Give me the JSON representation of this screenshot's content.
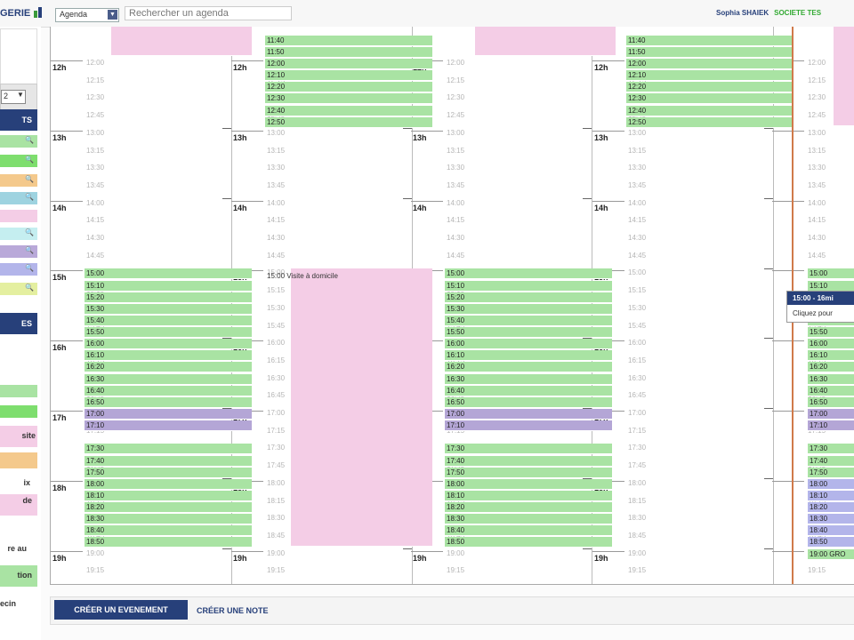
{
  "header": {
    "brand": "GERIE",
    "agenda_select": "Agenda",
    "search_placeholder": "Rechercher un agenda",
    "user_name": "Sophia SHAIEK",
    "company": "SOCIETE TES"
  },
  "sidebar": {
    "select_value": "2",
    "section1_header": "TS",
    "section2_header": "ES",
    "labels": [
      "site",
      "ix",
      "de",
      "re au",
      "tion",
      "ecin"
    ]
  },
  "calendar": {
    "hours": [
      "12h",
      "13h",
      "14h",
      "15h",
      "16h",
      "17h",
      "18h",
      "19h"
    ],
    "slot_times": [
      "12:00",
      "12:15",
      "12:30",
      "12:45",
      "13:00",
      "13:15",
      "13:30",
      "13:45",
      "14:00",
      "14:15",
      "14:30",
      "14:45",
      "15:00",
      "15:15",
      "15:30",
      "15:45",
      "16:00",
      "16:15",
      "16:30",
      "16:45",
      "17:00",
      "17:15",
      "17:30",
      "17:45",
      "18:00",
      "18:15",
      "18:30",
      "18:45",
      "19:00",
      "19:15"
    ],
    "event_times_top": [
      "11:40",
      "11:50",
      "12:00",
      "12:10",
      "12:20",
      "12:30",
      "12:40",
      "12:50"
    ],
    "event_times_pm": [
      "15:00",
      "15:10",
      "15:20",
      "15:30",
      "15:40",
      "15:50",
      "16:00",
      "16:10",
      "16:20",
      "16:30",
      "16:40",
      "16:50"
    ],
    "event_times_17": [
      "17:00",
      "17:10"
    ],
    "event_times_late": [
      "17:30",
      "17:40",
      "17:50",
      "18:00",
      "18:10",
      "18:20",
      "18:30",
      "18:40",
      "18:50"
    ],
    "visite_label": "15:00  Visite à  domicile",
    "last_col_event": "19:00 GRO",
    "tooltip_title": "15:00 - 16mi",
    "tooltip_text": "Cliquez pour"
  },
  "footer": {
    "create_event": "CRÉER UN EVENEMENT",
    "create_note": "CRÉER UNE NOTE"
  },
  "colors": {
    "navy": "#27407a",
    "green": "#a9e3a3",
    "purple": "#b4a6d6",
    "lavender": "#b3b5ea",
    "pink": "#f4cde6"
  }
}
